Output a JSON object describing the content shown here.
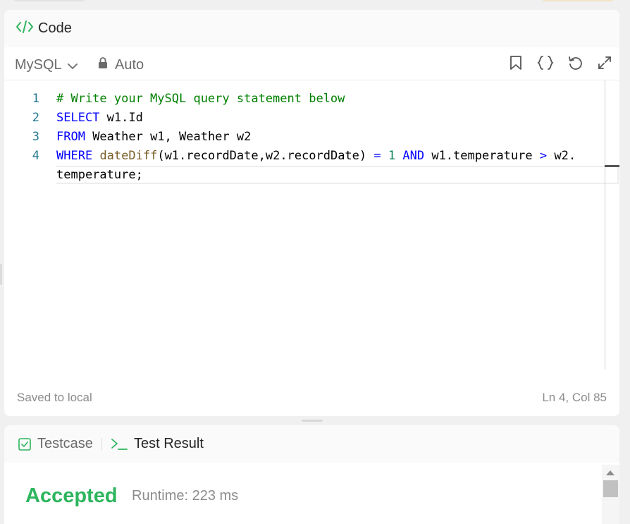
{
  "code_panel": {
    "title": "Code",
    "language": "MySQL",
    "mode": "Auto",
    "lines": [
      {
        "no": "1"
      },
      {
        "no": "2"
      },
      {
        "no": "3"
      },
      {
        "no": "4"
      }
    ],
    "code": {
      "l1": "# Write your MySQL query statement below",
      "l2_kw": "SELECT",
      "l2_rest": " w1.Id",
      "l3_kw": "FROM",
      "l3_rest": " Weather w1, Weather w2",
      "l4_kw": "WHERE",
      "l4_fn": "dateDiff",
      "l4_args": "(w1.recordDate,w2.recordDate) ",
      "l4_eq": "=",
      "l4_num": "1",
      "l4_and": "AND",
      "l4_a": " w1.temperature ",
      "l4_gt": ">",
      "l4_b": " w2.",
      "l5": "temperature;"
    },
    "status_saved": "Saved to local",
    "status_pos": "Ln 4, Col 85"
  },
  "result_panel": {
    "tab_testcase": "Testcase",
    "tab_result": "Test Result",
    "verdict": "Accepted",
    "runtime": "Runtime: 223 ms"
  },
  "colors": {
    "accent_green": "#2db55d",
    "keyword": "#0000ff",
    "comment": "#008000"
  }
}
